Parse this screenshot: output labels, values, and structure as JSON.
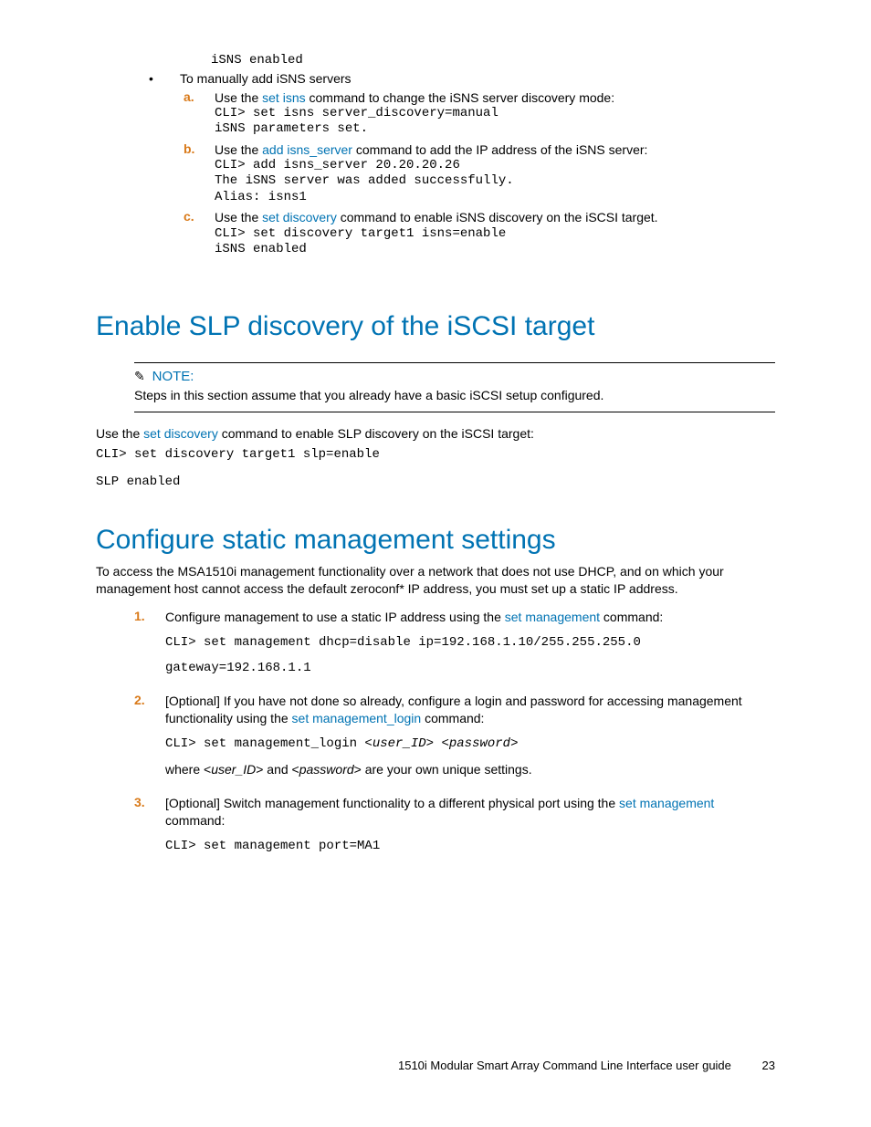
{
  "topCode": "iSNS enabled",
  "bullet1": "To manually add iSNS servers",
  "subA": {
    "marker": "a.",
    "pre": "Use the ",
    "link": "set isns",
    "post": " command to change the iSNS server discovery mode:",
    "code1": "CLI> set isns server_discovery=manual",
    "code2": "iSNS parameters set."
  },
  "subB": {
    "marker": "b.",
    "pre": "Use the ",
    "link": "add isns_server",
    "post": " command to add the IP address of the iSNS server:",
    "code1": "CLI> add isns_server 20.20.20.26",
    "code2": "The iSNS server was added successfully.",
    "code3": "Alias:  isns1"
  },
  "subC": {
    "marker": "c.",
    "pre": "Use the ",
    "link": "set discovery",
    "post": " command to enable iSNS discovery on the iSCSI target.",
    "code1": "CLI> set discovery target1 isns=enable",
    "code2": "iSNS enabled"
  },
  "section1": {
    "title": "Enable SLP discovery of the iSCSI target",
    "noteLabel": "NOTE:",
    "noteBody": "Steps in this section assume that you already have a basic iSCSI setup configured.",
    "bodyPre": "Use the ",
    "bodyLink": "set discovery",
    "bodyPost": " command to enable SLP discovery on the iSCSI target:",
    "code1": "CLI> set discovery target1 slp=enable",
    "code2": "SLP enabled"
  },
  "section2": {
    "title": "Configure static management settings",
    "intro": "To access the MSA1510i management functionality over a network that does not use DHCP, and on which your management host cannot access the default zeroconf* IP address, you must set up a static IP address.",
    "step1": {
      "marker": "1.",
      "pre": "Configure management to use a static IP address using the ",
      "link": "set management",
      "post": " command:",
      "code1": "CLI> set management dhcp=disable ip=192.168.1.10/255.255.255.0",
      "code2": "gateway=192.168.1.1"
    },
    "step2": {
      "marker": "2.",
      "pre": "[Optional] If you have not done so already, configure a login and password for accessing management functionality using the ",
      "link": "set management_login",
      "post": " command:",
      "codePre": "CLI> set management_login <",
      "codeUid": "user_ID",
      "codeMid": "> <",
      "codePwd": "password",
      "codeEnd": ">",
      "where1": "where <",
      "whereUid": "user_ID",
      "where2": "> and <",
      "wherePwd": "password",
      "where3": "> are your own unique settings."
    },
    "step3": {
      "marker": "3.",
      "pre": "[Optional] Switch management functionality to a different physical port using the ",
      "link": "set management",
      "post": " command:",
      "code1": "CLI> set management port=MA1"
    }
  },
  "footer": {
    "title": "1510i Modular Smart Array Command Line Interface user guide",
    "page": "23"
  }
}
